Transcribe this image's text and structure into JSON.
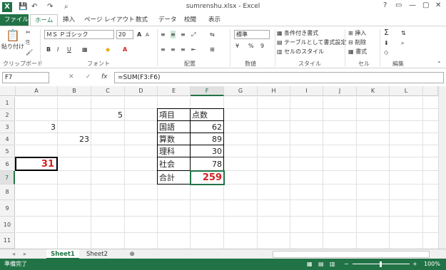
{
  "window": {
    "title": "sumrenshu.xlsx - Excel",
    "logo": "X",
    "controls": [
      "?",
      "▭",
      "—",
      "▢",
      "✕"
    ]
  },
  "quick_access": {
    "save": "💾",
    "undo": "↶",
    "redo": "↷",
    "preview": "⌕"
  },
  "tabs": [
    {
      "label": "ファイル"
    },
    {
      "label": "ホーム"
    },
    {
      "label": "挿入"
    },
    {
      "label": "ページ レイアウト"
    },
    {
      "label": "数式"
    },
    {
      "label": "データ"
    },
    {
      "label": "校閲"
    },
    {
      "label": "表示"
    }
  ],
  "ribbon": {
    "clipboard": {
      "paste": "貼り付け",
      "label": "クリップボード"
    },
    "font": {
      "name": "ＭＳ Ｐゴシック",
      "size": "20",
      "bold": "B",
      "italic": "I",
      "underline": "U",
      "color_a": "A",
      "grow": "A",
      "shrink": "A",
      "label": "フォント"
    },
    "alignment": {
      "label": "配置"
    },
    "number": {
      "format": "標準",
      "label": "数値",
      "percent": "%",
      "comma": "9"
    },
    "styles": {
      "cond": "条件付き書式",
      "table": "テーブルとして書式設定",
      "cell": "セルのスタイル",
      "label": "スタイル"
    },
    "cells": {
      "insert": "挿入",
      "delete": "削除",
      "format": "書式",
      "label": "セル"
    },
    "editing": {
      "label": "編集",
      "sum": "Σ"
    }
  },
  "formula_bar": {
    "name_box": "F7",
    "formula": "=SUM(F3:F6)",
    "cancel": "✕",
    "enter": "✓",
    "fx": "fx"
  },
  "columns": [
    "A",
    "B",
    "C",
    "D",
    "E",
    "F",
    "G",
    "H",
    "I",
    "J",
    "K",
    "L"
  ],
  "rows": [
    "1",
    "2",
    "3",
    "4",
    "5",
    "6",
    "7",
    "8",
    "9",
    "10",
    "11"
  ],
  "cells": {
    "C2": "5",
    "A3": "3",
    "B4": "23",
    "A6": "31",
    "E2": "項目",
    "F2": "点数",
    "E3": "国語",
    "F3": "62",
    "E4": "算数",
    "F4": "89",
    "E5": "理科",
    "F5": "30",
    "E6": "社会",
    "F6": "78",
    "E7": "合計",
    "F7": "259"
  },
  "sheets": [
    {
      "label": "Sheet1"
    },
    {
      "label": "Sheet2"
    }
  ],
  "status": {
    "text": "準備完了",
    "zoom": "100%",
    "minus": "−",
    "plus": "+"
  },
  "colors": {
    "excel_green": "#217346",
    "red_value": "#d42020"
  }
}
